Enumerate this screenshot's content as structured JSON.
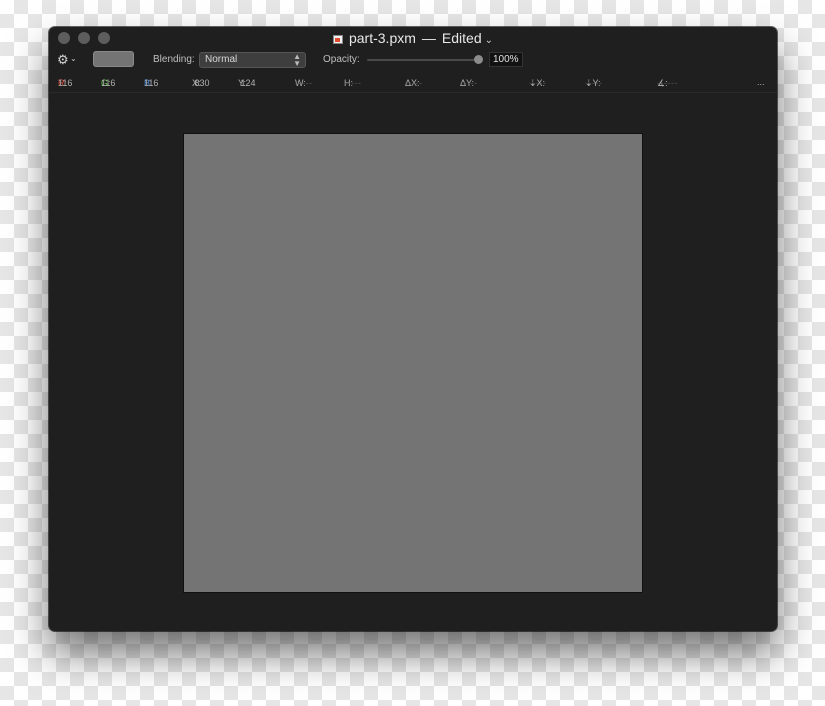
{
  "window": {
    "title": "part-3.pxm",
    "separator": "—",
    "status": "Edited"
  },
  "toolbar": {
    "blending_label": "Blending:",
    "blending_value": "Normal",
    "opacity_label": "Opacity:",
    "opacity_value": "100%",
    "opacity_fraction": 1.0,
    "swatch_color": "#747474"
  },
  "infobar": {
    "r_label": "R:",
    "r_value": "116",
    "g_label": "G:",
    "g_value": "116",
    "b_label": "B:",
    "b_value": "116",
    "x_label": "X:",
    "x_value": "830",
    "y_label": "Y:",
    "y_value": "124",
    "w_label": "W:",
    "w_value": "-----",
    "h_label": "H:",
    "h_value": "-----",
    "dx_label": "ΔX:",
    "dx_value": "-----",
    "dy_label": "ΔY:",
    "dy_value": "-----",
    "ax_label": "⇣X:",
    "ax_value": "-----",
    "ay_label": "⇣Y:",
    "ay_value": "-----",
    "angle_label": "∡:",
    "angle_value": "------",
    "more": "..."
  },
  "canvas": {
    "fill_color": "#747474"
  }
}
